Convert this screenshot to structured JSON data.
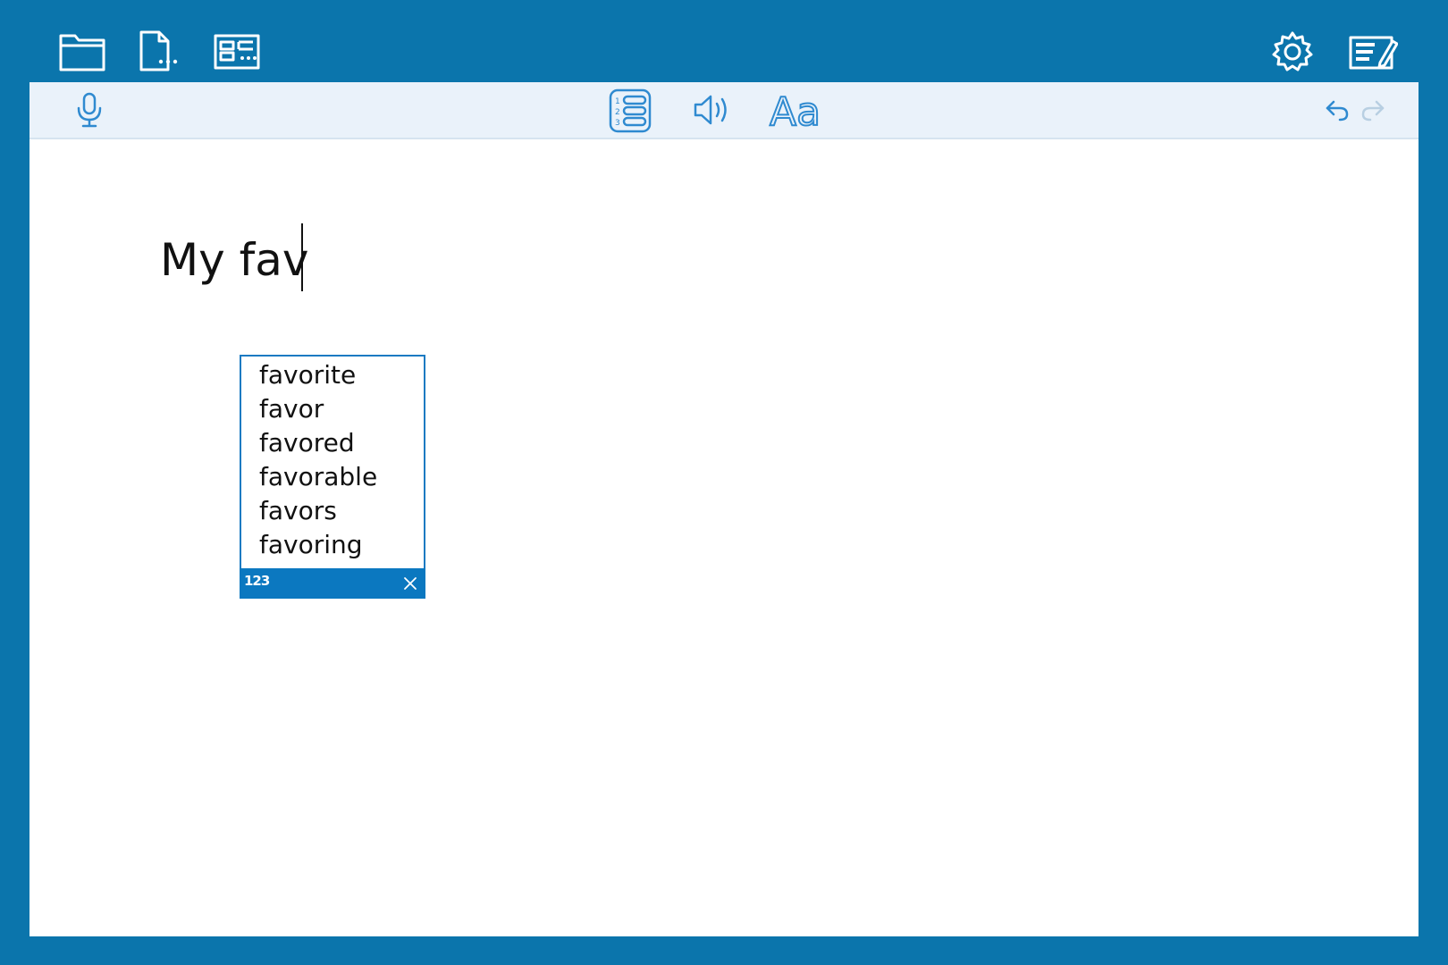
{
  "topbar": {
    "left_icons": [
      "folder-icon",
      "file-more-icon",
      "layout-icon"
    ],
    "right_icons": [
      "gear-icon",
      "checklist-edit-icon"
    ]
  },
  "toolbar": {
    "icons": [
      "microphone-icon",
      "numbered-list-icon",
      "speaker-icon",
      "font-icon",
      "undo-icon",
      "redo-icon"
    ],
    "font_label": "Aa"
  },
  "document": {
    "text": "My fav"
  },
  "prediction": {
    "suggestions": [
      "favorite",
      "favor",
      "favored",
      "favorable",
      "favors",
      "favoring"
    ],
    "numbers_label": "123",
    "close_icon": "close-icon"
  },
  "colors": {
    "background": "#0b75ac",
    "accent": "#0b78c0",
    "icon": "#2f8ad0",
    "toolbar_bg": "#eaf2fa"
  }
}
